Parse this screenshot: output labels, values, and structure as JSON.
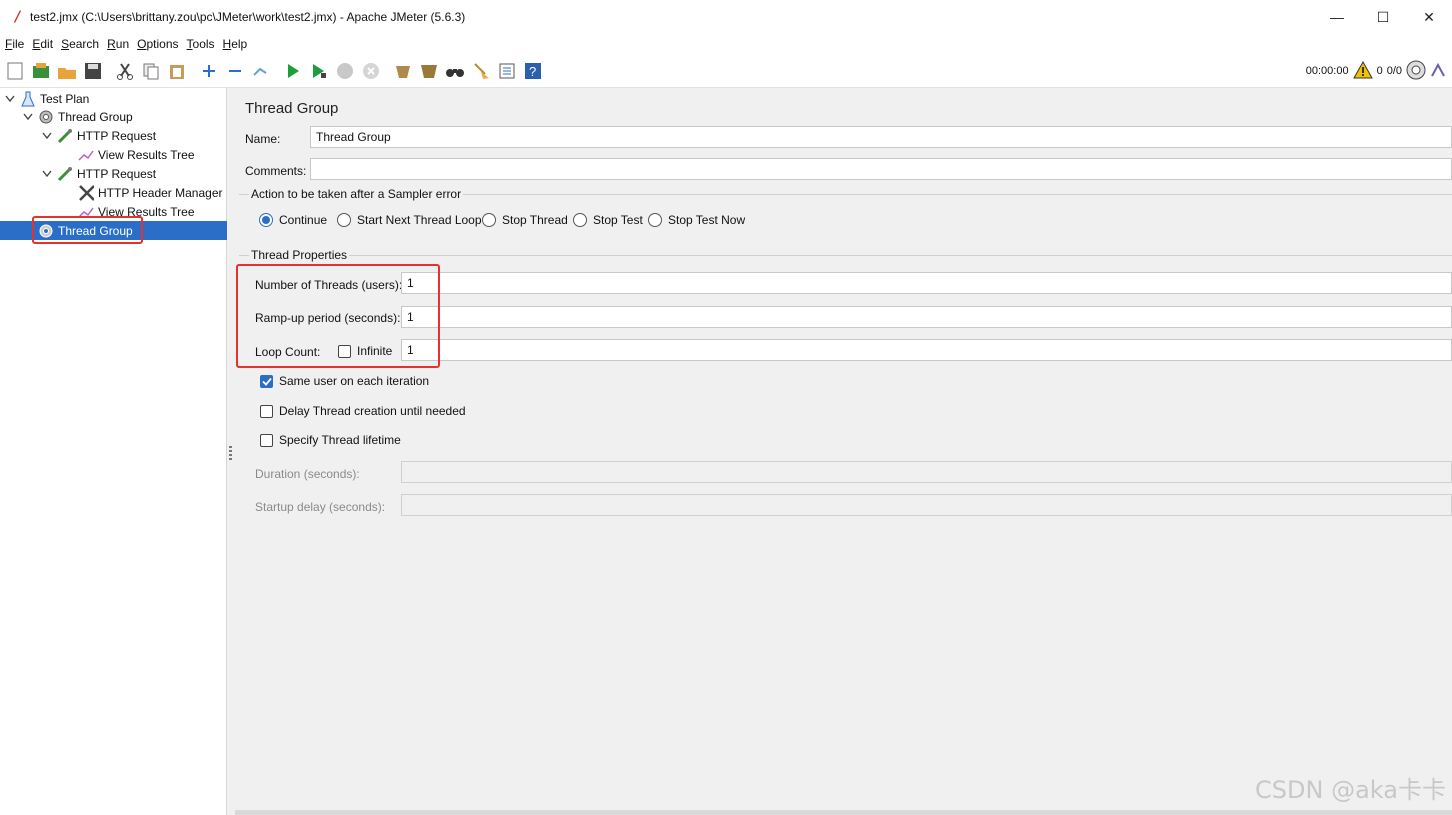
{
  "window": {
    "title": "test2.jmx (C:\\Users\\brittany.zou\\pc\\JMeter\\work\\test2.jmx) - Apache JMeter (5.6.3)",
    "minimize": "—",
    "maximize": "☐",
    "close": "✕"
  },
  "menu": [
    {
      "key": "F",
      "rest": "ile"
    },
    {
      "key": "E",
      "rest": "dit"
    },
    {
      "key": "S",
      "rest": "earch"
    },
    {
      "key": "R",
      "rest": "un"
    },
    {
      "key": "O",
      "rest": "ptions"
    },
    {
      "key": "T",
      "rest": "ools"
    },
    {
      "key": "H",
      "rest": "elp"
    }
  ],
  "status": {
    "timer": "00:00:00",
    "warnings": "0",
    "threads": "0/0"
  },
  "tree": {
    "test_plan": "Test Plan",
    "thread_group_1": "Thread Group",
    "http_request_1": "HTTP Request",
    "view_results_1": "View Results Tree",
    "http_request_2": "HTTP Request",
    "header_manager": "HTTP Header Manager",
    "view_results_2": "View Results Tree",
    "thread_group_2": "Thread Group"
  },
  "panel": {
    "title": "Thread Group",
    "name_label": "Name:",
    "name_value": "Thread Group",
    "comments_label": "Comments:",
    "comments_value": "",
    "action_group_title": "Action to be taken after a Sampler error",
    "actions": [
      "Continue",
      "Start Next Thread Loop",
      "Stop Thread",
      "Stop Test",
      "Stop Test Now"
    ],
    "selected_action": "Continue",
    "props_group_title": "Thread Properties",
    "threads_label": "Number of Threads (users):",
    "threads_value": "1",
    "rampup_label": "Ramp-up period (seconds):",
    "rampup_value": "1",
    "loop_label": "Loop Count:",
    "infinite_label": "Infinite",
    "loop_value": "1",
    "same_user_label": "Same user on each iteration",
    "delay_label": "Delay Thread creation until needed",
    "specify_label": "Specify Thread lifetime",
    "duration_label": "Duration (seconds):",
    "duration_value": "",
    "startup_label": "Startup delay (seconds):",
    "startup_value": ""
  },
  "checks": {
    "infinite": false,
    "same_user": true,
    "delay": false,
    "specify": false
  },
  "watermark": "CSDN @aka卡卡",
  "colors": {
    "selection": "#2b6ec8",
    "highlight": "#e5322d",
    "panel_bg": "#f0f0f0"
  }
}
